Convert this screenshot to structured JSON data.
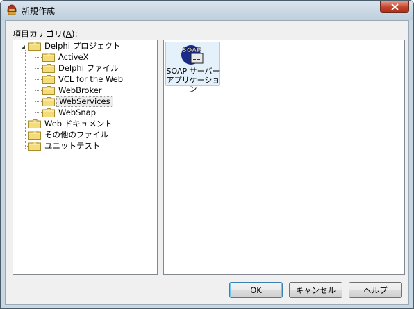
{
  "window": {
    "title": "新規作成"
  },
  "category": {
    "label": "項目カテゴリ(",
    "accel": "A",
    "label_suffix": "):"
  },
  "tree": {
    "items": [
      {
        "label": "Delphi プロジェクト",
        "expanded": true
      },
      {
        "label": "ActiveX"
      },
      {
        "label": "Delphi ファイル"
      },
      {
        "label": "VCL for the Web"
      },
      {
        "label": "WebBroker"
      },
      {
        "label": "WebServices",
        "selected": true
      },
      {
        "label": "WebSnap"
      },
      {
        "label": "Web ドキュメント"
      },
      {
        "label": "その他のファイル"
      },
      {
        "label": "ユニットテスト"
      }
    ]
  },
  "items": [
    {
      "line1": "SOAP サーバー",
      "line2": "アプリケーション",
      "icon": "soap-server-icon",
      "icon_text": "SOAP"
    }
  ],
  "buttons": {
    "ok": "OK",
    "cancel": "キャンセル",
    "help": "ヘルプ"
  },
  "colors": {
    "folder": "#f5dc7a",
    "selection": "#e4f1fb",
    "close": "#c3442c"
  }
}
